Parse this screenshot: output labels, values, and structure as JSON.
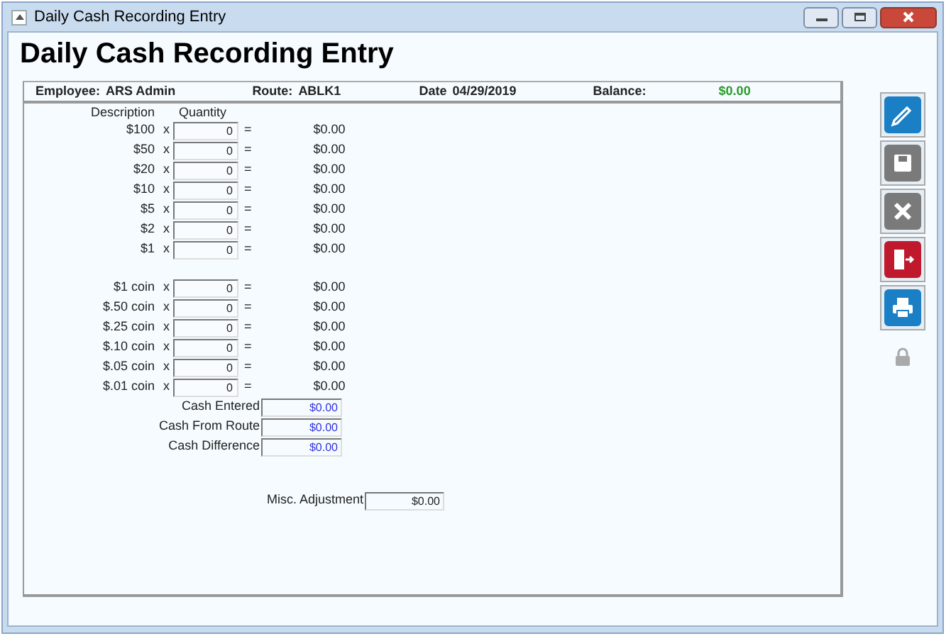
{
  "window": {
    "title": "Daily Cash Recording Entry"
  },
  "heading": "Daily Cash Recording Entry",
  "info_bar": {
    "employee_label": "Employee:",
    "employee": "ARS Admin",
    "route_label": "Route:",
    "route": "ABLK1",
    "date_label": "Date",
    "date": "04/29/2019",
    "balance_label": "Balance:",
    "balance": "$0.00"
  },
  "columns": [
    "Description",
    "Quantity"
  ],
  "bills": [
    {
      "description": "$100",
      "times": "x",
      "quantity": "0",
      "equals": "=",
      "amount": "$0.00"
    },
    {
      "description": "$50",
      "times": "x",
      "quantity": "0",
      "equals": "=",
      "amount": "$0.00"
    },
    {
      "description": "$20",
      "times": "x",
      "quantity": "0",
      "equals": "=",
      "amount": "$0.00"
    },
    {
      "description": "$10",
      "times": "x",
      "quantity": "0",
      "equals": "=",
      "amount": "$0.00"
    },
    {
      "description": "$5",
      "times": "x",
      "quantity": "0",
      "equals": "=",
      "amount": "$0.00"
    },
    {
      "description": "$2",
      "times": "x",
      "quantity": "0",
      "equals": "=",
      "amount": "$0.00"
    },
    {
      "description": "$1",
      "times": "x",
      "quantity": "0",
      "equals": "=",
      "amount": "$0.00"
    }
  ],
  "coins": [
    {
      "description": "$1 coin",
      "times": "x",
      "quantity": "0",
      "equals": "=",
      "amount": "$0.00"
    },
    {
      "description": "$.50 coin",
      "times": "x",
      "quantity": "0",
      "equals": "=",
      "amount": "$0.00"
    },
    {
      "description": "$.25 coin",
      "times": "x",
      "quantity": "0",
      "equals": "=",
      "amount": "$0.00"
    },
    {
      "description": "$.10 coin",
      "times": "x",
      "quantity": "0",
      "equals": "=",
      "amount": "$0.00"
    },
    {
      "description": "$.05 coin",
      "times": "x",
      "quantity": "0",
      "equals": "=",
      "amount": "$0.00"
    },
    {
      "description": "$.01 coin",
      "times": "x",
      "quantity": "0",
      "equals": "=",
      "amount": "$0.00"
    }
  ],
  "totals": [
    {
      "label": "Cash Entered",
      "value": "$0.00"
    },
    {
      "label": "Cash From Route",
      "value": "$0.00"
    },
    {
      "label": "Cash Difference",
      "value": "$0.00"
    }
  ],
  "misc_adjustment": {
    "label": "Misc. Adjustment",
    "value": "$0.00"
  },
  "toolbar": [
    {
      "kind": "edit",
      "disabled": false
    },
    {
      "kind": "save",
      "disabled": true
    },
    {
      "kind": "cancel",
      "disabled": true
    },
    {
      "kind": "exit",
      "disabled": false
    },
    {
      "kind": "print",
      "disabled": false
    }
  ]
}
